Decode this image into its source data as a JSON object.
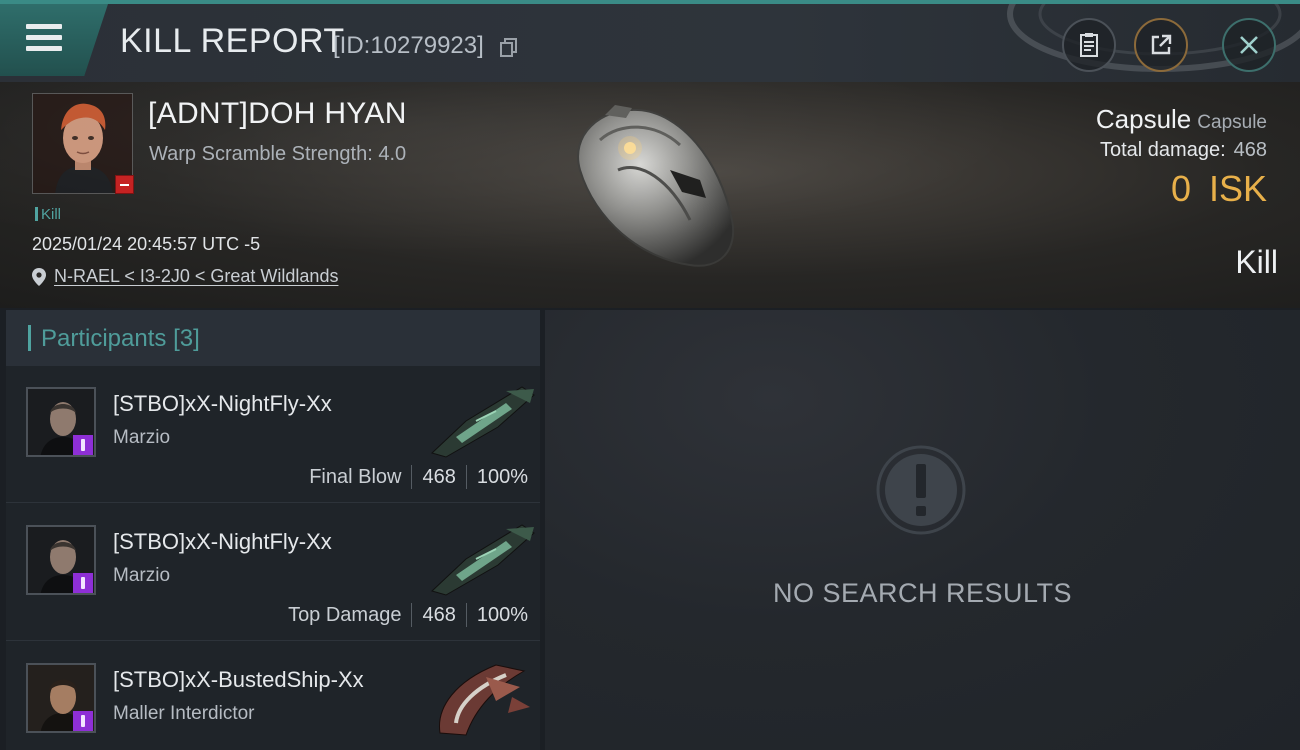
{
  "header": {
    "title": "KILL REPORT",
    "report_id": "[ID:10279923]",
    "icons": [
      "menu-icon",
      "copy-icon",
      "clipboard-icon",
      "share-icon",
      "close-icon"
    ]
  },
  "victim": {
    "name": "[ADNT]DOH HYAN",
    "warp_scramble": "Warp Scramble Strength: 4.0",
    "tag": "Kill",
    "timestamp": "2025/01/24 20:45:57 UTC -5",
    "location": "N-RAEL < I3-2J0 < Great Wildlands",
    "ship_name": "Capsule",
    "ship_class": "Capsule",
    "total_damage_label": "Total damage:",
    "total_damage": "468",
    "isk_value": "0",
    "isk_unit": "ISK",
    "result": "Kill"
  },
  "participants": {
    "label": "Participants",
    "count": "[3]",
    "rows": [
      {
        "name": "[STBO]xX-NightFly-Xx",
        "ship": "Marzio",
        "role": "Final Blow",
        "damage": "468",
        "percent": "100%"
      },
      {
        "name": "[STBO]xX-NightFly-Xx",
        "ship": "Marzio",
        "role": "Top Damage",
        "damage": "468",
        "percent": "100%"
      },
      {
        "name": "[STBO]xX-BustedShip-Xx",
        "ship": "Maller Interdictor",
        "role": "",
        "damage": "",
        "percent": ""
      }
    ]
  },
  "results_panel": {
    "empty_text": "NO SEARCH RESULTS"
  },
  "colors": {
    "accent_teal": "#4fa3a0",
    "isk_gold": "#e8b04a",
    "loss_badge_red": "#c41e1e",
    "corp_badge_purple": "#8e2fd6"
  }
}
